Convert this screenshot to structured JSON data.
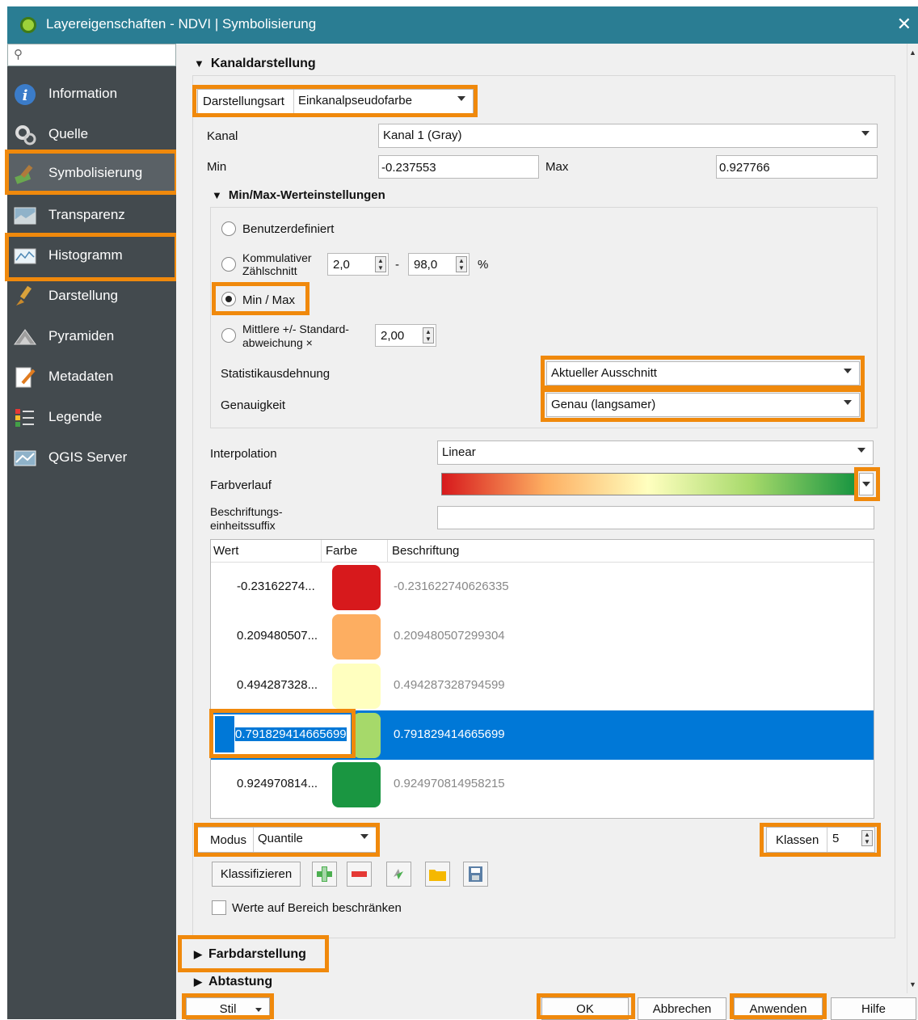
{
  "window": {
    "title": "Layereigenschaften - NDVI | Symbolisierung",
    "close_label": "✕"
  },
  "sidebar": {
    "search_placeholder": "",
    "items": [
      {
        "label": "Information",
        "icon": "info-icon"
      },
      {
        "label": "Quelle",
        "icon": "source-icon"
      },
      {
        "label": "Symbolisierung",
        "icon": "paintbrush-icon"
      },
      {
        "label": "Transparenz",
        "icon": "transparency-icon"
      },
      {
        "label": "Histogramm",
        "icon": "histogram-icon"
      },
      {
        "label": "Darstellung",
        "icon": "brush-icon"
      },
      {
        "label": "Pyramiden",
        "icon": "pyramid-icon"
      },
      {
        "label": "Metadaten",
        "icon": "metadata-icon"
      },
      {
        "label": "Legende",
        "icon": "legend-icon"
      },
      {
        "label": "QGIS Server",
        "icon": "server-icon"
      }
    ]
  },
  "kanal_section": {
    "title": "Kanaldarstellung",
    "darstellungsart_label": "Darstellungsart",
    "darstellungsart_value": "Einkanalpseudofarbe",
    "kanal_label": "Kanal",
    "kanal_value": "Kanal 1 (Gray)",
    "min_label": "Min",
    "min_value": "-0.237553",
    "max_label": "Max",
    "max_value": "0.927766"
  },
  "minmax": {
    "title": "Min/Max-Werteinstellungen",
    "benutzerdefiniert": "Benutzerdefiniert",
    "kumulativ_line1": "Kommulativer",
    "kumulativ_line2": "Zählschnitt",
    "kumulativ_from": "2,0",
    "kumulativ_dash": "-",
    "kumulativ_to": "98,0",
    "percent": "%",
    "minmax_label": "Min / Max",
    "mittlere_line1": "Mittlere +/- Standard-",
    "mittlere_line2": "abweichung ×",
    "mittlere_value": "2,00",
    "statistik_label": "Statistikausdehnung",
    "statistik_value": "Aktueller Ausschnitt",
    "genauigkeit_label": "Genauigkeit",
    "genauigkeit_value": "Genau (langsamer)"
  },
  "interpolation": {
    "label": "Interpolation",
    "value": "Linear",
    "farbverlauf_label": "Farbverlauf",
    "suffix_line1": "Beschriftungs-",
    "suffix_line2": "einheitssuffix",
    "suffix_value": ""
  },
  "table": {
    "headers": [
      "Wert",
      "Farbe",
      "Beschriftung"
    ],
    "rows": [
      {
        "wert": "-0.23162274...",
        "color": "#d7191c",
        "beschriftung": "-0.231622740626335"
      },
      {
        "wert": "0.209480507...",
        "color": "#fdae61",
        "beschriftung": "0.209480507299304"
      },
      {
        "wert": "0.494287328...",
        "color": "#ffffbf",
        "beschriftung": "0.494287328794599"
      },
      {
        "wert": "0.791829414665699",
        "color": "#a6d96a",
        "beschriftung": "0.791829414665699"
      },
      {
        "wert": "0.924970814...",
        "color": "#1a9641",
        "beschriftung": "0.924970814958215"
      }
    ]
  },
  "modus": {
    "label": "Modus",
    "value": "Quantile",
    "klassen_label": "Klassen",
    "klassen_value": "5"
  },
  "klassifizieren_label": "Klassifizieren",
  "werte_beschraenken": "Werte auf Bereich beschränken",
  "collapsed_sections": [
    "Farbdarstellung",
    "Abtastung"
  ],
  "buttons": {
    "stil": "Stil",
    "ok": "OK",
    "abbrechen": "Abbrechen",
    "anwenden": "Anwenden",
    "hilfe": "Hilfe"
  },
  "accent_color": "#f0890c",
  "selection_color": "#0078d7"
}
